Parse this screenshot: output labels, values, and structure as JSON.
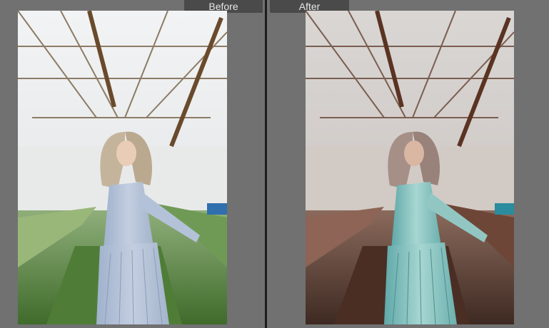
{
  "compare": {
    "before_label": "Before",
    "after_label": "After"
  },
  "colors": {
    "background": "#717171",
    "label_bg": "#4a4a4a",
    "label_text": "#e6e6e6",
    "divider": "#1d1d1d"
  }
}
